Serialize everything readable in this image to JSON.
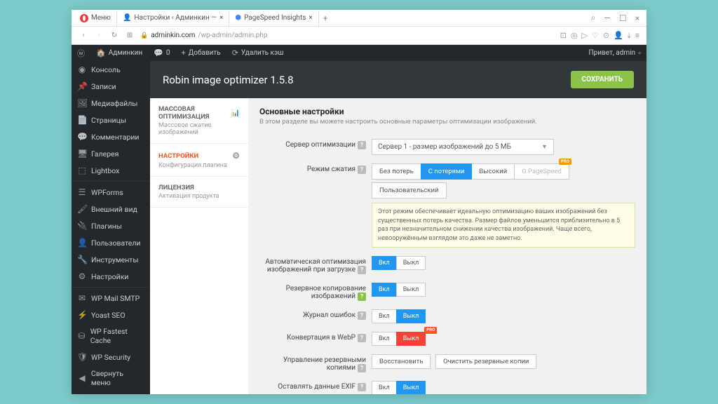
{
  "browser": {
    "menu": "Меню",
    "tabs": [
      {
        "title": "Настройки ‹ Админкин —",
        "icon": "👤"
      },
      {
        "title": "PageSpeed Insights",
        "icon": "⬢"
      }
    ],
    "url_domain": "adminkin.com",
    "url_path": "/wp-admin/admin.php"
  },
  "wpbar": {
    "site": "Админкин",
    "comments": "0",
    "add": "Добавить",
    "clear_cache": "Удалить кэш",
    "greeting": "Привет, admin"
  },
  "sidebar": {
    "items": [
      "Консоль",
      "Записи",
      "Медиафайлы",
      "Страницы",
      "Комментарии",
      "Галерея",
      "Lightbox",
      "WPForms",
      "Внешний вид",
      "Плагины",
      "Пользователи",
      "Инструменты",
      "Настройки",
      "WP Mail SMTP",
      "Yoast SEO",
      "WP Fastest Cache",
      "WP Security",
      "Свернуть меню"
    ],
    "icons": [
      "◉",
      "📌",
      "🖼",
      "📄",
      "💬",
      "🖥",
      "⬚",
      "☰",
      "🖌",
      "🔌",
      "👤",
      "🔧",
      "⚙",
      "✉",
      "⚡",
      "⛁",
      "🛡",
      "◀"
    ]
  },
  "header": {
    "title": "Robin image optimizer 1.5.8",
    "save": "СОХРАНИТЬ"
  },
  "tabs": [
    {
      "name": "МАССОВАЯ ОПТИМИЗАЦИЯ",
      "desc": "Массовое сжатие изображений",
      "icon": "chart"
    },
    {
      "name": "НАСТРОЙКИ",
      "desc": "Конфигурация плагина",
      "icon": "gear",
      "active": true
    },
    {
      "name": "ЛИЦЕНЗИЯ",
      "desc": "Активация продукта"
    }
  ],
  "settings": {
    "title": "Основные настройки",
    "subtitle": "В этом разделе вы можете настроить основные параметры оптимизации изображений.",
    "server_label": "Сервер оптимизации",
    "server_value": "Сервер 1 - размер изображений до 5 МБ",
    "mode_label": "Режим сжатия",
    "mode_options": [
      "Без потерь",
      "С потерями",
      "Высокий",
      "G PageSpeed",
      "Пользовательский"
    ],
    "mode_active": 1,
    "mode_pro_badge": "PRO",
    "mode_notice": "Этот режим обеспечивает идеальную оптимизацию ваших изображений без существенных потерь качества. Размер файлов уменьшится приблизительно в 5 раз при незначительном снижении качества изображений. Чаще всего, невооружённым взглядом это даже не заметно.",
    "auto_label": "Автоматическая оптимизация изображений при загрузке",
    "backup_label": "Резервное копирование изображений",
    "log_label": "Журнал ошибок",
    "webp_label": "Конвертация в WebP",
    "backup_manage_label": "Управление резервными копиями",
    "backup_restore": "Восстановить",
    "backup_clear": "Очистить резервные копии",
    "exif_label": "Оставлять данные EXIF",
    "toggle_on": "Вкл",
    "toggle_off": "Выкл",
    "pro_badge": "PRO"
  }
}
